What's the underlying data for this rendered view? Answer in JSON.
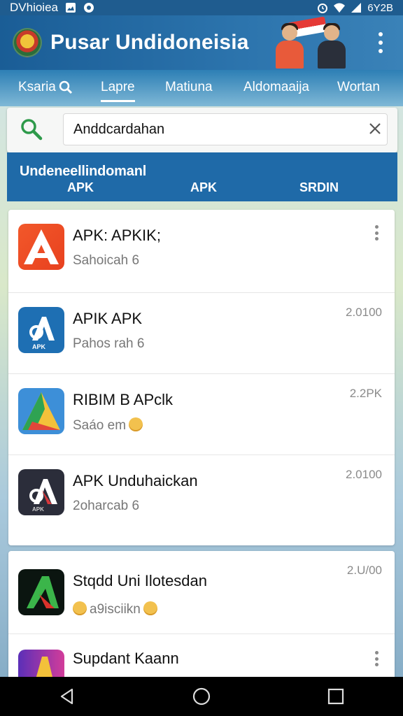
{
  "status_bar": {
    "carrier": "DVhioiea",
    "battery": "6Y2B"
  },
  "app_bar": {
    "title": "Pusar Undidoneisia"
  },
  "tabs": [
    {
      "label": "Ksaria",
      "active": false,
      "has_icon": true
    },
    {
      "label": "Lapre",
      "active": true
    },
    {
      "label": "Matiuna",
      "active": false
    },
    {
      "label": "Aldomaaija",
      "active": false
    },
    {
      "label": "Wortan",
      "active": false
    }
  ],
  "search": {
    "value": "Anddcardahan"
  },
  "header_band": {
    "title": "Undeneellindomanl",
    "columns": [
      "APK",
      "APK",
      "SRDIN"
    ]
  },
  "apps": [
    {
      "title": "APK: APKIK;",
      "subtitle": "Sahoicah 6",
      "size": "",
      "icon": "apk-orange-icon",
      "has_more": true,
      "emoji": false
    },
    {
      "title": "APIK APK",
      "subtitle": "Pahos rah 6",
      "size": "2.0100",
      "icon": "apk-blue-icon",
      "has_more": false,
      "emoji": false
    },
    {
      "title": "RIBIM B APclk",
      "subtitle": "Saáo em",
      "size": "2.2PK",
      "icon": "apk-gradient-icon",
      "has_more": false,
      "emoji": true
    },
    {
      "title": "APK Unduhaickan",
      "subtitle": "2oharcab 6",
      "size": "2.0100",
      "icon": "apk-dark-icon",
      "has_more": false,
      "emoji": false
    },
    {
      "title": "Stqdd Uni Ilotesdan",
      "subtitle": "a9isciikn",
      "size": "2.U/00",
      "icon": "apk-green-icon",
      "has_more": false,
      "emoji": true
    },
    {
      "title": "Supdant Kaann",
      "subtitle": "",
      "size": "",
      "icon": "apk-purple-icon",
      "has_more": true,
      "emoji": false
    }
  ],
  "colors": {
    "primary": "#1f5c8f",
    "band": "#1f6aa8",
    "search_green": "#2e9a4a"
  }
}
